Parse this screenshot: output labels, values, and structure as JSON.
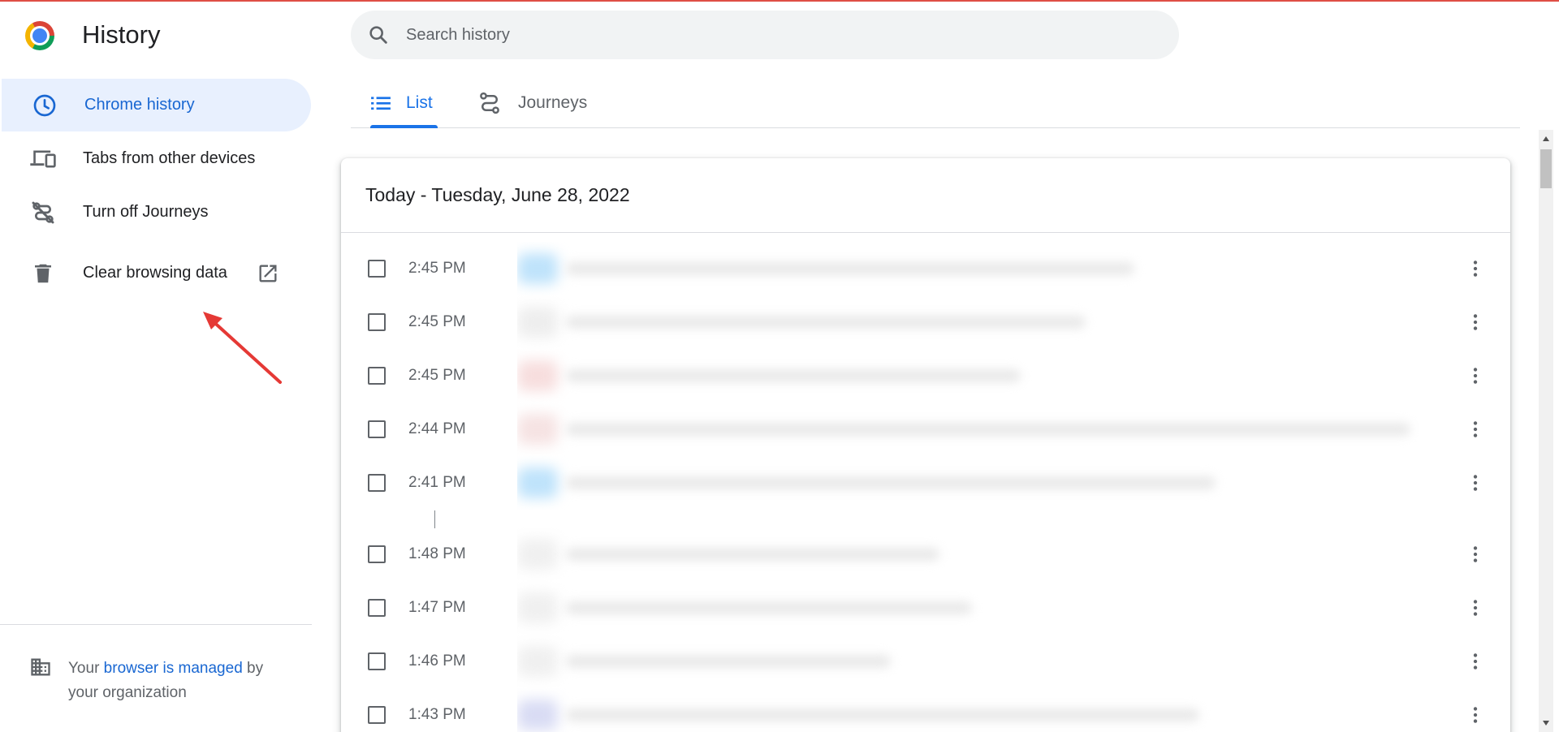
{
  "app": {
    "title": "History"
  },
  "colors": {
    "accent": "#1a73e8",
    "active_nav_bg": "#e8f0fe",
    "link": "#1967d2",
    "text_secondary": "#5f6368",
    "arrow": "#e53935"
  },
  "sidebar": {
    "items": [
      {
        "label": "Chrome history",
        "icon": "clock-icon",
        "active": true
      },
      {
        "label": "Tabs from other devices",
        "icon": "devices-icon",
        "active": false
      },
      {
        "label": "Turn off Journeys",
        "icon": "journeys-off-icon",
        "active": false
      },
      {
        "label": "Clear browsing data",
        "icon": "trash-icon",
        "active": false,
        "external": "open-in-new-icon"
      }
    ],
    "managed": {
      "prefix": "Your ",
      "link": "browser is managed",
      "suffix": " by your organization",
      "icon": "building-icon"
    }
  },
  "search": {
    "placeholder": "Search history",
    "icon": "search-icon"
  },
  "tabs": [
    {
      "label": "List",
      "icon": "list-icon",
      "active": true
    },
    {
      "label": "Journeys",
      "icon": "journeys-icon",
      "active": false
    }
  ],
  "history": {
    "date_heading": "Today - Tuesday, June 28, 2022",
    "entries": [
      {
        "time": "2:45 PM"
      },
      {
        "time": "2:45 PM"
      },
      {
        "time": "2:45 PM"
      },
      {
        "time": "2:44 PM"
      },
      {
        "time": "2:41 PM"
      },
      {
        "time": "1:48 PM"
      },
      {
        "time": "1:47 PM"
      },
      {
        "time": "1:46 PM"
      },
      {
        "time": "1:43 PM"
      }
    ]
  }
}
